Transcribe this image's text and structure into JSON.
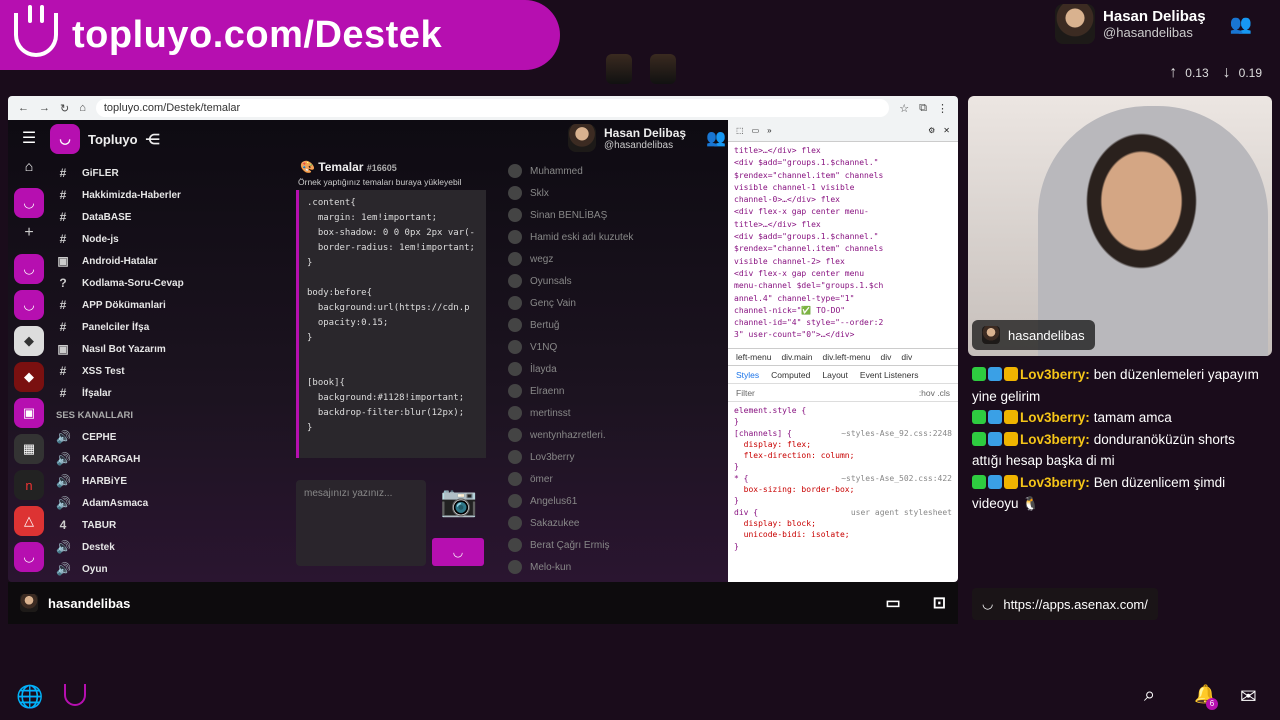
{
  "banner": {
    "text": "topluyo.com/Destek"
  },
  "profile": {
    "name": "Hasan Delibaş",
    "handle": "@hasandelibas"
  },
  "stats": {
    "up": "0.13",
    "down": "0.19"
  },
  "browser": {
    "url": "topluyo.com/Destek/temalar"
  },
  "app": {
    "name": "Topluyo",
    "channels": [
      {
        "icon": "#",
        "label": "GiFLER"
      },
      {
        "icon": "#",
        "label": "Hakkimizda-Haberler"
      },
      {
        "icon": "#",
        "label": "DataBASE"
      },
      {
        "icon": "#",
        "label": "Node-js"
      },
      {
        "icon": "▣",
        "label": "Android-Hatalar"
      },
      {
        "icon": "?",
        "label": "Kodlama-Soru-Cevap"
      },
      {
        "icon": "#",
        "label": "APP Dökümanlari"
      },
      {
        "icon": "#",
        "label": "Panelciler İfşa"
      },
      {
        "icon": "▣",
        "label": "Nasıl Bot Yazarım"
      },
      {
        "icon": "#",
        "label": "XSS Test"
      },
      {
        "icon": "#",
        "label": "İfşalar"
      }
    ],
    "voice_section": "SES KANALLARI",
    "voice": [
      {
        "icon": "🔊",
        "label": "CEPHE"
      },
      {
        "icon": "🔊",
        "label": "KARARGAH"
      },
      {
        "icon": "🔊",
        "label": "HARBiYE"
      },
      {
        "icon": "🔊",
        "label": "AdamAsmaca"
      },
      {
        "icon": "4",
        "label": "TABUR"
      },
      {
        "icon": "🔊",
        "label": "Destek"
      },
      {
        "icon": "🔊",
        "label": "Oyun"
      }
    ],
    "chat_title": "Temalar",
    "chat_id": "#16605",
    "chat_sub": "Örnek yaptığınız temaları buraya yükleyebil",
    "code": ".content{\n  margin: 1em!important;\n  box-shadow: 0 0 0px 2px var(-\n  border-radius: 1em!important;\n}\n\nbody:before{\n  background:url(https://cdn.p\n  opacity:0.15;\n}\n\n\n[book]{\n  background:#1128!important;\n  backdrop-filter:blur(12px);\n}",
    "placeholder": "mesajınızı yazınız...",
    "members": [
      "Muhammed",
      "Sklx",
      "Sinan BENLİBAŞ",
      "Hamid eski adı kuzutek",
      "wegz",
      "Oyunsals",
      "Genç Vain",
      "Bertuğ",
      "V1NQ",
      "İlayda",
      "Elraenn",
      "mertinsst",
      "wentynhazretleri.",
      "Lov3berry",
      "ömer",
      "Angelus61",
      "Sakazukee",
      "Berat Çağrı Ermiş",
      "Melo-kun"
    ]
  },
  "devtools": {
    "dom": [
      "title>…</div> flex",
      "<div $add=\"groups.1.$channel.\"",
      "$rendex=\"channel.item\" channels",
      "visible channel-1 visible",
      "channel-0>…</div> flex",
      "<div flex-x gap center menu-",
      "title>…</div> flex",
      "<div $add=\"groups.1.$channel.\"",
      "$rendex=\"channel.item\" channels",
      "visible channel-2> flex",
      "<div flex-x gap center menu",
      "menu-channel $del=\"groups.1.$ch",
      "annel.4\" channel-type=\"1\"",
      "channel-nick=\"✅ TO-DO\"",
      "channel-id=\"4\" style=\"--order:2",
      "3\" user-count=\"0\">…</div>"
    ],
    "crumbs": [
      "left-menu",
      "div.main",
      "div.left-menu",
      "div",
      "div"
    ],
    "tabs": [
      "Styles",
      "Computed",
      "Layout",
      "Event Listeners"
    ],
    "filter": "Filter",
    "filter_btns": ":hov .cls",
    "css": [
      {
        "sel": "element.style {",
        "src": ""
      },
      {
        "sel": "}",
        "src": ""
      },
      {
        "sel": "[channels] {",
        "src": "~styles-Ase_92.css:2248"
      },
      {
        "sel": "  display: flex;",
        "src": ""
      },
      {
        "sel": "  flex-direction: column;",
        "src": ""
      },
      {
        "sel": "}",
        "src": ""
      },
      {
        "sel": "* {",
        "src": "~styles-Ase_502.css:422"
      },
      {
        "sel": "  box-sizing: border-box;",
        "src": ""
      },
      {
        "sel": "}",
        "src": ""
      },
      {
        "sel": "div {",
        "src": "user agent stylesheet"
      },
      {
        "sel": "  display: block;",
        "src": ""
      },
      {
        "sel": "  unicode-bidi: isolate;",
        "src": ""
      },
      {
        "sel": "}",
        "src": ""
      }
    ]
  },
  "bottom": {
    "name": "hasandelibas"
  },
  "cam": {
    "label": "hasandelibas"
  },
  "livechat": [
    {
      "user": "Lov3berry:",
      "text": "ben düzenlemeleri yapayım yine gelirim"
    },
    {
      "user": "Lov3berry:",
      "text": "tamam amca"
    },
    {
      "user": "Lov3berry:",
      "text": "donduranöküzün shorts attığı hesap başka di mi"
    },
    {
      "user": "Lov3berry:",
      "text": "Ben düzenlicem şimdi videoyu 🐧"
    }
  ],
  "link": "https://apps.asenax.com/",
  "notif_count": "6"
}
